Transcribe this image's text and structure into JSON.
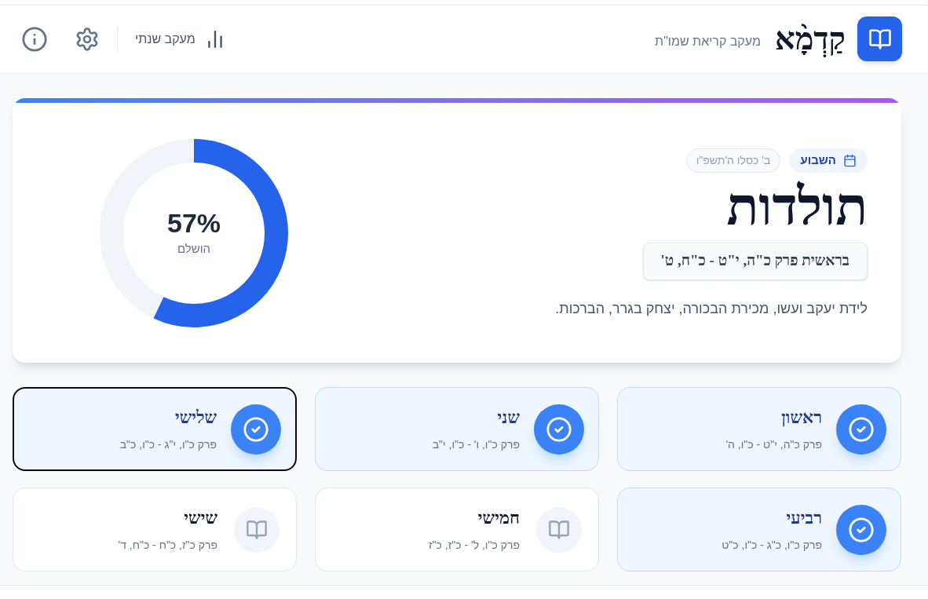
{
  "header": {
    "logo_text": "קַדְמָ֨א",
    "subtitle": "מעקב קריאת שמו\"ת",
    "yearly_button": "מעקב שנתי"
  },
  "parasha": {
    "badge": "השבוע",
    "date": "ב' כסלו ה'תשפ\"ו",
    "name": "תולדות",
    "reference": "בראשית פרק כ\"ה, י\"ט - כ\"ח, ט'",
    "summary": "לידת יעקב ועשו, מכירת הבכורה, יצחק בגרר, הברכות."
  },
  "progress": {
    "level": 0.57,
    "percent": "57%",
    "label": "הושלם"
  },
  "aliyot": [
    {
      "name": "ראשון",
      "range": "פרק כ\"ה, י\"ט - כ\"ו, ה'",
      "completed": true,
      "selected": false
    },
    {
      "name": "שני",
      "range": "פרק כ\"ו, ו' - כ\"ו, י\"ב",
      "completed": true,
      "selected": false
    },
    {
      "name": "שלישי",
      "range": "פרק כ\"ו, י\"ג - כ\"ו, כ\"ב",
      "completed": true,
      "selected": true
    },
    {
      "name": "רביעי",
      "range": "פרק כ\"ו, כ\"ג - כ\"ו, כ\"ט",
      "completed": true,
      "selected": false
    },
    {
      "name": "חמישי",
      "range": "פרק כ\"ו, ל' - כ\"ז, כ\"ז",
      "completed": false,
      "selected": false
    },
    {
      "name": "שישי",
      "range": "פרק כ\"ז, כ\"ח - כ\"ח, ד'",
      "completed": false,
      "selected": false
    }
  ]
}
